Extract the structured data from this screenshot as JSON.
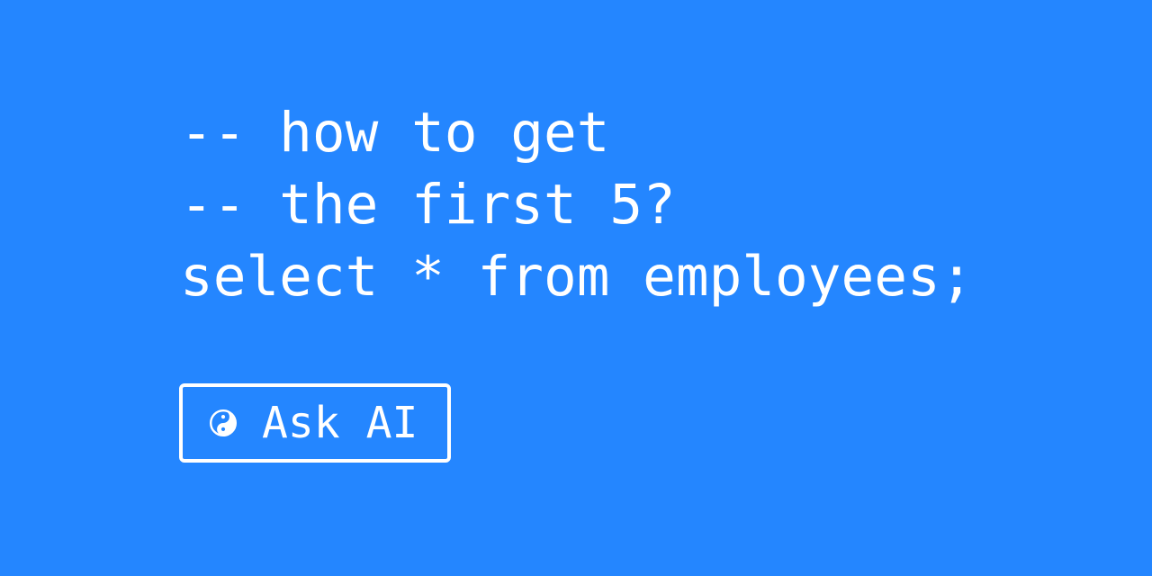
{
  "theme": {
    "background": "#2486ff",
    "foreground": "#ffffff"
  },
  "code": {
    "lines": [
      "-- how to get",
      "-- the first 5?",
      "select * from employees;"
    ]
  },
  "ask_ai_button": {
    "icon": "yin-yang-icon",
    "label": "Ask AI"
  }
}
